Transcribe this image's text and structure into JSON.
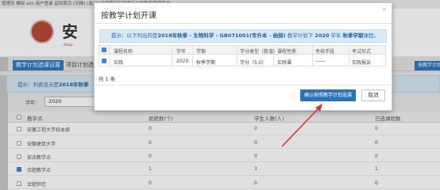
{
  "topbar": {
    "text": "管理员 模拟 xkh 用户登录 返回首页 [切换] [退出] 欢迎使用安徽理工大学教务管理系统"
  },
  "header": {
    "logo_char": "安",
    "logo_sub": "Anhui"
  },
  "tabs": [
    {
      "label": "教学计划选课设置",
      "active": true
    },
    {
      "label": "项目计划选课",
      "active": false
    }
  ],
  "top_right_button": "按教学计划开课",
  "page_hint": {
    "prefix": "提示：列表显示是",
    "bold": "2018年秋季"
  },
  "filter": {
    "year_label": "学年：",
    "year_value": "2020"
  },
  "main_table": {
    "headers": [
      "教学点",
      "拒绝数(个)",
      "学生人数(人)",
      "已选课程数"
    ],
    "rows": [
      {
        "checked": false,
        "name": "安徽工程大学校本部",
        "c1": "0",
        "c2": "0",
        "c3": "0"
      },
      {
        "checked": false,
        "name": "安徽建筑大学",
        "c1": "0",
        "c2": "0",
        "c3": "0"
      },
      {
        "checked": false,
        "name": "安庆教学点",
        "c1": "0",
        "c2": "0",
        "c3": "0"
      },
      {
        "checked": true,
        "name": "合肥教学点",
        "c1": "1",
        "c2": "3",
        "c3": "1"
      },
      {
        "checked": false,
        "name": "合肥师范",
        "c1": "0",
        "c2": "0",
        "c3": "0"
      }
    ]
  },
  "modal": {
    "title": "按教学计划开课",
    "close": "×",
    "hint": {
      "p1": "提示：以下列出的是",
      "b1": "2018年秋季 - 生物科学 - GB071001(专升本 - 函授)",
      "p2": "教学计划下",
      "b2": "2020",
      "p3": "学年",
      "b3": "秋季学期",
      "p4": "课程。"
    },
    "columns": [
      "课程名称",
      "学年",
      "学期",
      "学分类型（数值）",
      "课程性质",
      "考核手段",
      "考试形式"
    ],
    "rows": [
      {
        "checked": true,
        "name": "实践",
        "year": "2020",
        "term": "秋季学期",
        "credit": "学分（5.0）",
        "nature": "实践课",
        "assess": "——",
        "exam": "实践报告"
      }
    ],
    "count": "共 1 条",
    "confirm": "确认按照教学计划选课",
    "cancel": "取消"
  },
  "colors": {
    "primary": "#2b72bd",
    "hint_bg": "#d9e9f6",
    "arrow": "#e0302a"
  }
}
